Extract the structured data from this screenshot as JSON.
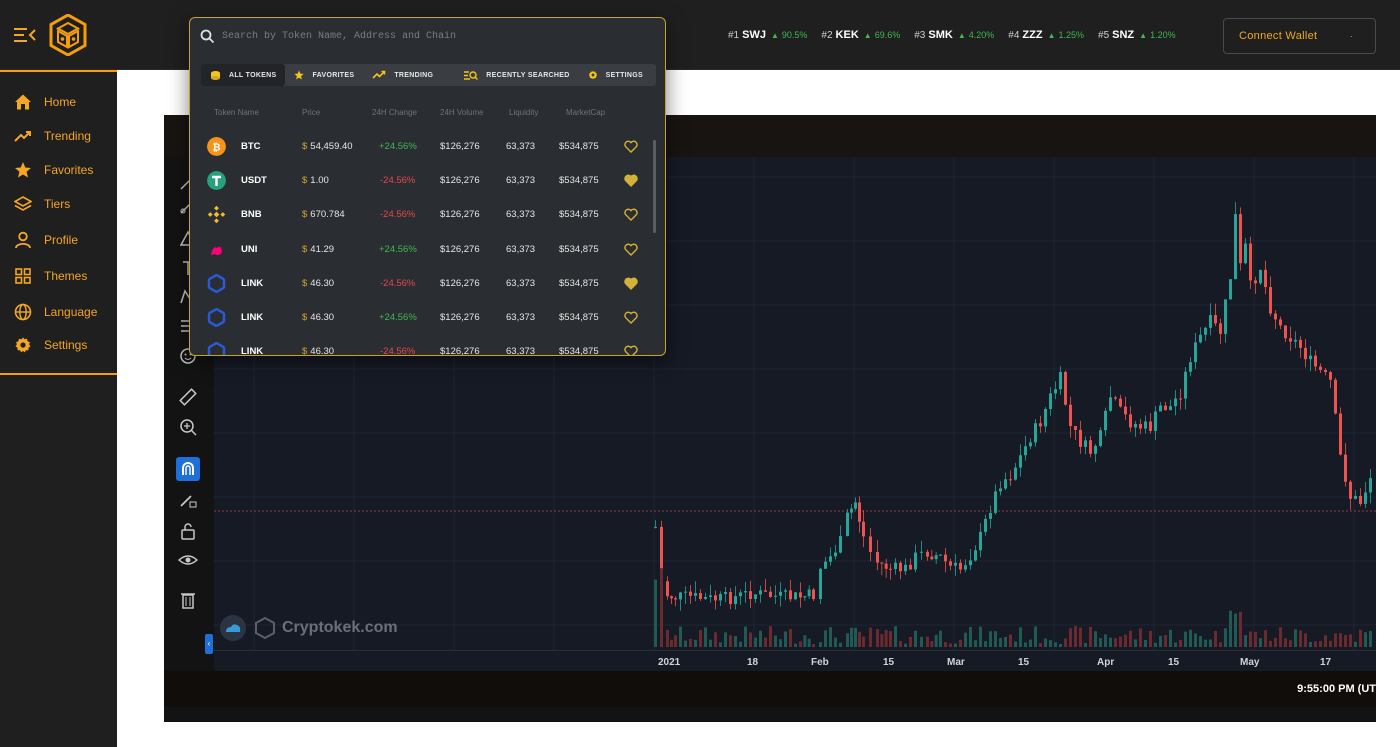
{
  "brand": {
    "logo_icon": "cube-logo-icon",
    "accent": "#f59e0b"
  },
  "tickers": [
    {
      "rank": "#1",
      "symbol": "SWJ",
      "change": "90.5%"
    },
    {
      "rank": "#2",
      "symbol": "KEK",
      "change": "69.6%"
    },
    {
      "rank": "#3",
      "symbol": "SMK",
      "change": "4.20%"
    },
    {
      "rank": "#4",
      "symbol": "ZZZ",
      "change": "1.25%"
    },
    {
      "rank": "#5",
      "symbol": "SNZ",
      "change": "1.20%"
    }
  ],
  "header": {
    "connect_wallet": "Connect Wallet"
  },
  "sidebar": {
    "items": [
      {
        "label": "Home",
        "icon": "home-icon"
      },
      {
        "label": "Trending",
        "icon": "trending-icon"
      },
      {
        "label": "Favorites",
        "icon": "star-icon"
      },
      {
        "label": "Tiers",
        "icon": "layers-icon"
      },
      {
        "label": "Profile",
        "icon": "user-icon"
      },
      {
        "label": "Themes",
        "icon": "grid-icon"
      },
      {
        "label": "Language",
        "icon": "globe-icon"
      },
      {
        "label": "Settings",
        "icon": "gear-icon"
      }
    ]
  },
  "search": {
    "placeholder": "Search by Token Name, Address and Chain",
    "tabs": [
      {
        "label": "ALL TOKENS",
        "icon": "coins-icon",
        "active": true
      },
      {
        "label": "FAVORITES",
        "icon": "star-icon",
        "active": false
      },
      {
        "label": "TRENDING",
        "icon": "trending-icon",
        "active": false
      },
      {
        "label": "RECENTLY SEARCHED",
        "icon": "search-list-icon",
        "active": false
      },
      {
        "label": "SETTINGS",
        "icon": "gear-icon",
        "active": false
      }
    ],
    "columns": [
      "Token Name",
      "Price",
      "24H Change",
      "24H Volume",
      "Liquidity",
      "MarketCap"
    ],
    "rows": [
      {
        "symbol": "BTC",
        "price": "54,459.40",
        "change": "+24.56%",
        "direction": "up",
        "volume": "$126,276",
        "liquidity": "63,373",
        "marketcap": "$534,875",
        "favorite": false,
        "coin_color": "#f7931a"
      },
      {
        "symbol": "USDT",
        "price": "1.00",
        "change": "-24.56%",
        "direction": "down",
        "volume": "$126,276",
        "liquidity": "63,373",
        "marketcap": "$534,875",
        "favorite": true,
        "coin_color": "#26a17b"
      },
      {
        "symbol": "BNB",
        "price": "670.784",
        "change": "-24.56%",
        "direction": "down",
        "volume": "$126,276",
        "liquidity": "63,373",
        "marketcap": "$534,875",
        "favorite": false,
        "coin_color": "#f3ba2f"
      },
      {
        "symbol": "UNI",
        "price": "41.29",
        "change": "+24.56%",
        "direction": "up",
        "volume": "$126,276",
        "liquidity": "63,373",
        "marketcap": "$534,875",
        "favorite": false,
        "coin_color": "#ff007a"
      },
      {
        "symbol": "LINK",
        "price": "46.30",
        "change": "-24.56%",
        "direction": "down",
        "volume": "$126,276",
        "liquidity": "63,373",
        "marketcap": "$534,875",
        "favorite": true,
        "coin_color": "#2a5ada"
      },
      {
        "symbol": "LINK",
        "price": "46.30",
        "change": "+24.56%",
        "direction": "up",
        "volume": "$126,276",
        "liquidity": "63,373",
        "marketcap": "$534,875",
        "favorite": false,
        "coin_color": "#2a5ada"
      },
      {
        "symbol": "LINK",
        "price": "46.30",
        "change": "-24.56%",
        "direction": "down",
        "volume": "$126,276",
        "liquidity": "63,373",
        "marketcap": "$534,875",
        "favorite": false,
        "coin_color": "#2a5ada"
      }
    ]
  },
  "chart": {
    "time_labels": [
      "2021",
      "18",
      "Feb",
      "15",
      "Mar",
      "15",
      "Apr",
      "15",
      "May",
      "17"
    ],
    "watermark": "Cryptokek.com",
    "clock": "9:55:00 PM (UT",
    "up_color": "#26a69a",
    "down_color": "#ef5350"
  },
  "chart_data": {
    "type": "candlestick",
    "x": [
      "2021",
      "18",
      "Feb",
      "15",
      "Mar",
      "15",
      "Apr",
      "15",
      "May",
      "17"
    ]
  }
}
